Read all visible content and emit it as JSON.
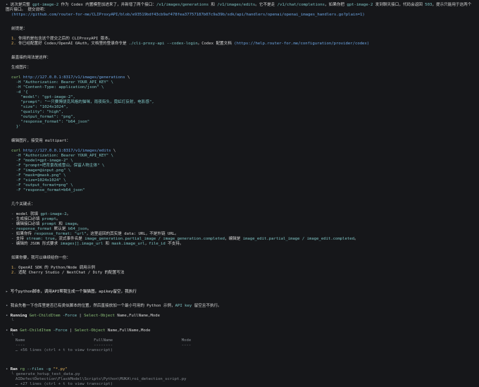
{
  "intro": {
    "line1_a": "这次是完整 ",
    "line1_model": "gpt-image-2",
    "line1_b": " 作为 Codex 内置模型加进来了，并新增了两个接口：",
    "line1_ep1": "/v1/images/generations",
    "line1_c": " 和 ",
    "line1_ep2": "/v1/images/edits",
    "line1_d": "。它不是走 ",
    "line1_ep3": "/v1/chat/completions",
    "line1_e": "，如果你把 ",
    "line1_model2": "gpt-image-2",
    "line1_f": " 发到聊天接口，代码会返回 ",
    "line1_code": "503",
    "line1_g": "，提示只能用于这两个图片接口。 提交说明：",
    "line2_link": "(https://github.com/router-for-me/CLIProxyAPI/blob/e93519bdf43cb9af478fea37757187b07c9a39b/sdk/api/handlers/openai/openai_images_handlers.go?plain=1)"
  },
  "prereq": {
    "title": "前提是：",
    "items": [
      {
        "num": "1.",
        "text": "你用的是包含这个提交之后的 CLIProxyAPI 版本。"
      },
      {
        "num": "2.",
        "text_a": "你已经配置好 Codex/OpenAI OAuth，文档里的登录命令是 ",
        "cmd": "./cli-proxy-api --codex-login",
        "text_b": "。Codex 配置文档 ",
        "link": "(https://help.router-for.me/configuration/provider/codex)"
      }
    ]
  },
  "adapted_title": "最直接的用法是这样：",
  "gen": {
    "title": "生成图片：",
    "lines": [
      "curl http://127.0.0.1:8317/v1/images/generations \\",
      "  -H \"Authorization: Bearer YOUR_API_KEY\" \\",
      "  -H \"Content-Type: application/json\" \\",
      "  -d '{",
      "    \"model\": \"gpt-image-2\",",
      "    \"prompt\": \"一只赛博朋克风格的猫咪，雨夜街头，霓虹灯反射，电影感\",",
      "    \"size\": \"1024x1024\",",
      "    \"quality\": \"high\",",
      "    \"output_format\": \"png\",",
      "    \"response_format\": \"b64_json\"",
      "  }'"
    ]
  },
  "edit": {
    "title": "编辑图片，接受用 multipart：",
    "lines": [
      "curl http://127.0.0.1:8317/v1/images/edits \\",
      "  -H \"Authorization: Bearer YOUR_API_KEY\" \\",
      "  -F \"model=gpt-image-2\" \\",
      "  -F \"prompt=把背景改成雪山，保留人物主体\" \\",
      "  -F \"image=@input.png\" \\",
      "  -F \"mask=@mask.png\" \\",
      "  -F \"size=1024x1024\" \\",
      "  -F \"output_format=png\" \\",
      "  -F \"response_format=b64_json\""
    ]
  },
  "keypoints": {
    "title": "几个关键点：",
    "items": [
      {
        "a": "model 就填 ",
        "c1": "gpt-image-2",
        "b": "。"
      },
      {
        "a": "生成接口必填 ",
        "c1": "prompt",
        "b": "。"
      },
      {
        "a": "编辑接口必填 ",
        "c1": "prompt",
        "b": " 和 ",
        "c2": "image",
        "d": "。"
      },
      {
        "a": "",
        "c1": "response_format",
        "b": " 默认是 ",
        "c2": "b64_json",
        "d": "。"
      },
      {
        "a": "如果你传 ",
        "c1": "response_format: \"url\"",
        "b": "，这里返回的其实是 data: URL，不是外链 URL。"
      },
      {
        "a": "支持 ",
        "c1": "stream: true",
        "b": "，流式事件名是 ",
        "c2": "image_generation.partial_image / image_generation.completed",
        "d": "，编辑是 ",
        "c3": "image_edit.partial_image / image_edit.completed",
        "e": "。"
      },
      {
        "a": "编辑的 JSON 形式要求 ",
        "c1": "images[].image_url",
        "b": " 和 ",
        "c2": "mask.image_url",
        "d": "，",
        "c3": "file_id",
        "e": " 不支持。"
      }
    ]
  },
  "followup": {
    "title": "如果你要，我可以继续给你一份：",
    "items": [
      {
        "num": "1.",
        "text": "OpenAI SDK 的 Python/Node 调用示例"
      },
      {
        "num": "2.",
        "text": "适配 Cherry Studio / NextChat / Dify 的配置写法"
      }
    ]
  },
  "user1": "写个python脚本，调用API帮我生成一个猫猫图，apikey留空，我执行",
  "reply1_a": "我会先看一下仓库里是否已有类似脚本的位置，然后直接放加一个最小可用的 Python 示例，",
  "reply1_api": "API key",
  "reply1_b": " 留空且不执行。",
  "run1": {
    "label": "Running ",
    "cmd": "Get-ChildItem -Force | Select-Object Name,FullName,Mode"
  },
  "ran1": {
    "label": "Ran ",
    "cmd": "Get-ChildItem -Force | Select-Object Name,FullName,Mode",
    "sub1": "└",
    "head_name": "Name",
    "head_full": "FullName",
    "head_mode": "Mode",
    "more": "… +56 lines (ctrl + t to view transcript)"
  },
  "ran2": {
    "label": "Ran ",
    "cmd": "rg --files -g \"*.py\"",
    "sub1": "generate_hotup_test_data.py",
    "sub2": "AIDefectDetection\\FlaskModel\\Scripts\\Python\\MUKA\\roi_detection_script.py",
    "more": "… +27 lines (ctrl + t to view transcript)"
  },
  "glyphs": {
    "dot": "•",
    "dash": "-",
    "bullet2": "▸",
    "pipe": "└"
  }
}
